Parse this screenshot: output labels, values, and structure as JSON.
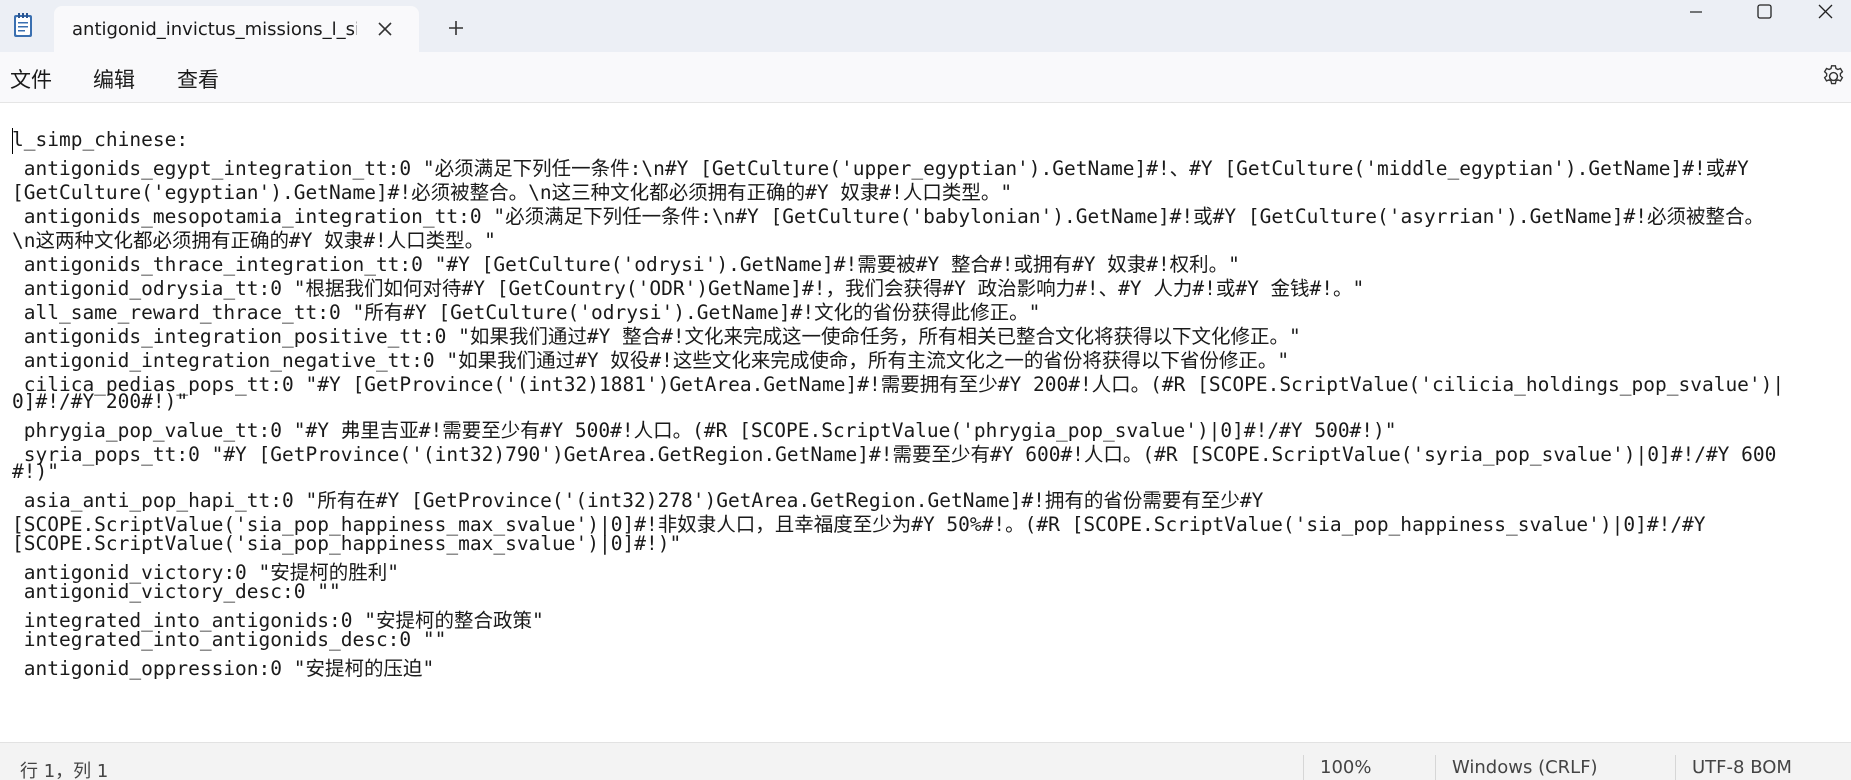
{
  "tab": {
    "title": "antigonid_invictus_missions_l_simp_chinese.yml"
  },
  "window": {
    "accent": "#1e90ff",
    "titlebar_bg": "#eceff5"
  },
  "menu": {
    "file": "文件",
    "edit": "编辑",
    "view": "查看"
  },
  "icons": [
    "notepad-app-icon",
    "close-icon",
    "plus-icon",
    "minimize-icon",
    "maximize-icon",
    "close-window-icon",
    "gear-icon"
  ],
  "editor": {
    "lines": [
      "l_simp_chinese:",
      " antigonids_egypt_integration_tt:0 \"必须满足下列任一条件:\\n#Y [GetCulture('upper_egyptian').GetName]#!、#Y [GetCulture('middle_egyptian').GetName]#!或#Y",
      "[GetCulture('egyptian').GetName]#!必须被整合。\\n这三种文化都必须拥有正确的#Y 奴隶#!人口类型。\"",
      " antigonids_mesopotamia_integration_tt:0 \"必须满足下列任一条件:\\n#Y [GetCulture('babylonian').GetName]#!或#Y [GetCulture('asyrrian').GetName]#!必须被整合。",
      "\\n这两种文化都必须拥有正确的#Y 奴隶#!人口类型。\"",
      " antigonids_thrace_integration_tt:0 \"#Y [GetCulture('odrysi').GetName]#!需要被#Y 整合#!或拥有#Y 奴隶#!权利。\"",
      " antigonid_odrysia_tt:0 \"根据我们如何对待#Y [GetCountry('ODR')GetName]#!，我们会获得#Y 政治影响力#!、#Y 人力#!或#Y 金钱#!。\"",
      " all_same_reward_thrace_tt:0 \"所有#Y [GetCulture('odrysi').GetName]#!文化的省份获得此修正。\"",
      " antigonids_integration_positive_tt:0 \"如果我们通过#Y 整合#!文化来完成这一使命任务，所有相关已整合文化将获得以下文化修正。\"",
      " antigonid_integration_negative_tt:0 \"如果我们通过#Y 奴役#!这些文化来完成使命，所有主流文化之一的省份将获得以下省份修正。\"",
      " cilica_pedias_pops_tt:0 \"#Y [GetProvince('(int32)1881')GetArea.GetName]#!需要拥有至少#Y 200#!人口。(#R [SCOPE.ScriptValue('cilicia_holdings_pop_svalue')|",
      "0]#!/#Y 200#!)\"",
      " phrygia_pop_value_tt:0 \"#Y 弗里吉亚#!需要至少有#Y 500#!人口。(#R [SCOPE.ScriptValue('phrygia_pop_svalue')|0]#!/#Y 500#!)\"",
      " syria_pops_tt:0 \"#Y [GetProvince('(int32)790')GetArea.GetRegion.GetName]#!需要至少有#Y 600#!人口。(#R [SCOPE.ScriptValue('syria_pop_svalue')|0]#!/#Y 600",
      "#!)\"",
      " asia_anti_pop_hapi_tt:0 \"所有在#Y [GetProvince('(int32)278')GetArea.GetRegion.GetName]#!拥有的省份需要有至少#Y",
      "[SCOPE.ScriptValue('sia_pop_happiness_max_svalue')|0]#!非奴隶人口，且幸福度至少为#Y 50%#!。(#R [SCOPE.ScriptValue('sia_pop_happiness_svalue')|0]#!/#Y",
      "[SCOPE.ScriptValue('sia_pop_happiness_max_svalue')|0]#!)\"",
      " antigonid_victory:0 \"安提柯的胜利\"",
      " antigonid_victory_desc:0 \"\"",
      " integrated_into_antigonids:0 \"安提柯的整合政策\"",
      " integrated_into_antigonids_desc:0 \"\"",
      " antigonid_oppression:0 \"安提柯的压迫\""
    ]
  },
  "status": {
    "position": "行 1，列 1",
    "zoom": "100%",
    "line_ending": "Windows (CRLF)",
    "encoding": "UTF-8 BOM"
  }
}
